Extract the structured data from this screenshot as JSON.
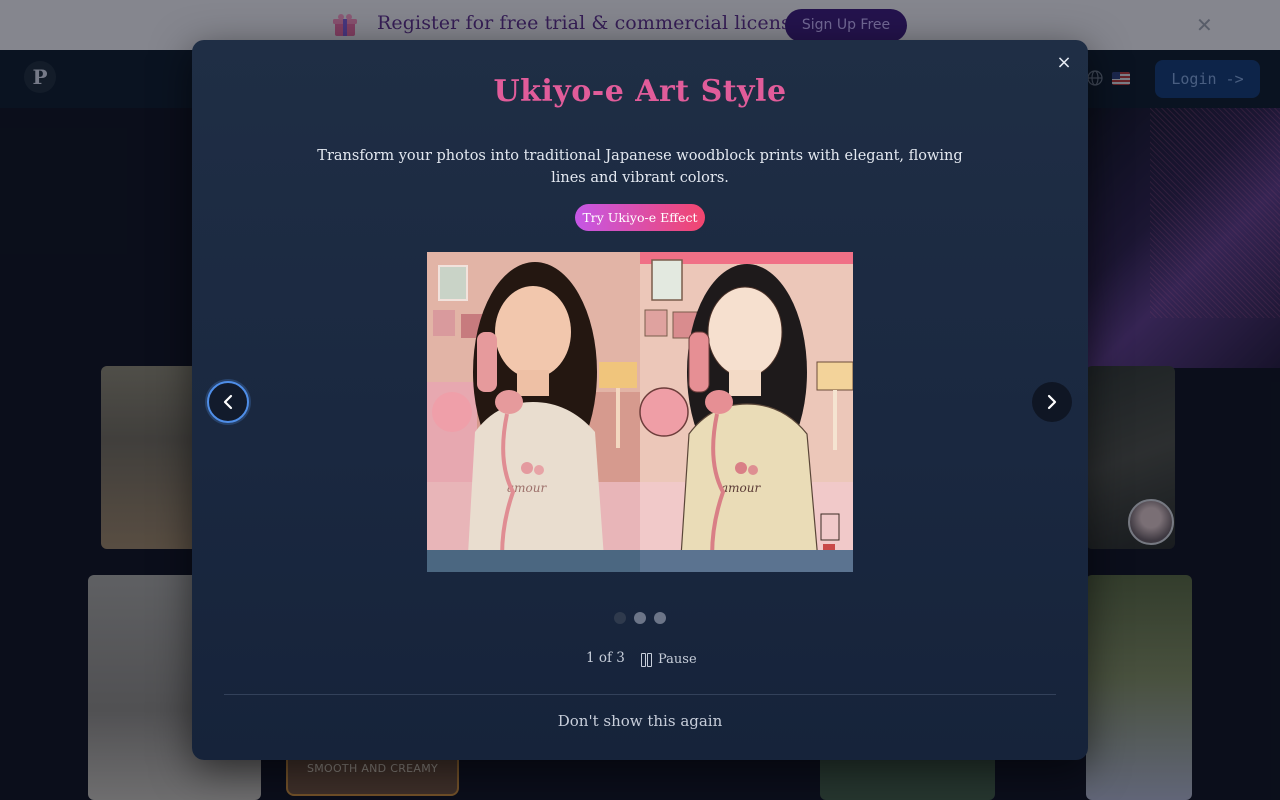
{
  "banner": {
    "text": "Register for free trial & commercial license",
    "signup_label": "Sign Up Free",
    "close_label": "✕",
    "icon": "gift-icon"
  },
  "nav": {
    "logo_text": "P",
    "login_label": "Login ->",
    "icons": [
      "globe-icon",
      "us-flag-icon"
    ]
  },
  "background": {
    "card_label": "SMOOTH AND CREAMY"
  },
  "modal": {
    "close_label": "×",
    "title": "Ukiyo-e Art Style",
    "description": "Transform your photos into traditional Japanese woodblock prints with elegant, flowing lines and vibrant colors.",
    "cta_label": "Try Ukiyo-e Effect",
    "images": [
      "original-photo",
      "ukiyo-e-result"
    ],
    "slide_count": 3,
    "active_slide": 1,
    "counter": "1 of 3",
    "pause_label": "Pause",
    "dont_show_label": "Don't show this again",
    "icons": [
      "chevron-left-icon",
      "chevron-right-icon",
      "pause-icon",
      "close-icon"
    ]
  },
  "colors": {
    "title": "#e15c9a",
    "cta_gradient_start": "#c557e6",
    "cta_gradient_end": "#f2466e",
    "modal_bg": "#1f2e45",
    "accent_ring": "#4f8ee8"
  }
}
